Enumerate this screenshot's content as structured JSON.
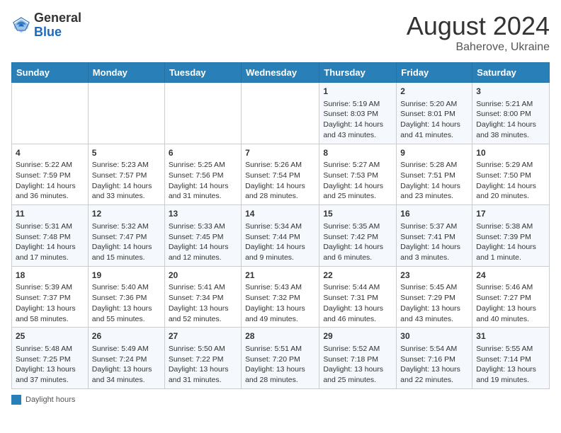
{
  "header": {
    "logo_general": "General",
    "logo_blue": "Blue",
    "month_year": "August 2024",
    "location": "Baherove, Ukraine"
  },
  "days_of_week": [
    "Sunday",
    "Monday",
    "Tuesday",
    "Wednesday",
    "Thursday",
    "Friday",
    "Saturday"
  ],
  "legend": {
    "label": "Daylight hours"
  },
  "weeks": [
    [
      {
        "day": "",
        "sunrise": "",
        "sunset": "",
        "daylight": ""
      },
      {
        "day": "",
        "sunrise": "",
        "sunset": "",
        "daylight": ""
      },
      {
        "day": "",
        "sunrise": "",
        "sunset": "",
        "daylight": ""
      },
      {
        "day": "",
        "sunrise": "",
        "sunset": "",
        "daylight": ""
      },
      {
        "day": "1",
        "sunrise": "Sunrise: 5:19 AM",
        "sunset": "Sunset: 8:03 PM",
        "daylight": "Daylight: 14 hours and 43 minutes."
      },
      {
        "day": "2",
        "sunrise": "Sunrise: 5:20 AM",
        "sunset": "Sunset: 8:01 PM",
        "daylight": "Daylight: 14 hours and 41 minutes."
      },
      {
        "day": "3",
        "sunrise": "Sunrise: 5:21 AM",
        "sunset": "Sunset: 8:00 PM",
        "daylight": "Daylight: 14 hours and 38 minutes."
      }
    ],
    [
      {
        "day": "4",
        "sunrise": "Sunrise: 5:22 AM",
        "sunset": "Sunset: 7:59 PM",
        "daylight": "Daylight: 14 hours and 36 minutes."
      },
      {
        "day": "5",
        "sunrise": "Sunrise: 5:23 AM",
        "sunset": "Sunset: 7:57 PM",
        "daylight": "Daylight: 14 hours and 33 minutes."
      },
      {
        "day": "6",
        "sunrise": "Sunrise: 5:25 AM",
        "sunset": "Sunset: 7:56 PM",
        "daylight": "Daylight: 14 hours and 31 minutes."
      },
      {
        "day": "7",
        "sunrise": "Sunrise: 5:26 AM",
        "sunset": "Sunset: 7:54 PM",
        "daylight": "Daylight: 14 hours and 28 minutes."
      },
      {
        "day": "8",
        "sunrise": "Sunrise: 5:27 AM",
        "sunset": "Sunset: 7:53 PM",
        "daylight": "Daylight: 14 hours and 25 minutes."
      },
      {
        "day": "9",
        "sunrise": "Sunrise: 5:28 AM",
        "sunset": "Sunset: 7:51 PM",
        "daylight": "Daylight: 14 hours and 23 minutes."
      },
      {
        "day": "10",
        "sunrise": "Sunrise: 5:29 AM",
        "sunset": "Sunset: 7:50 PM",
        "daylight": "Daylight: 14 hours and 20 minutes."
      }
    ],
    [
      {
        "day": "11",
        "sunrise": "Sunrise: 5:31 AM",
        "sunset": "Sunset: 7:48 PM",
        "daylight": "Daylight: 14 hours and 17 minutes."
      },
      {
        "day": "12",
        "sunrise": "Sunrise: 5:32 AM",
        "sunset": "Sunset: 7:47 PM",
        "daylight": "Daylight: 14 hours and 15 minutes."
      },
      {
        "day": "13",
        "sunrise": "Sunrise: 5:33 AM",
        "sunset": "Sunset: 7:45 PM",
        "daylight": "Daylight: 14 hours and 12 minutes."
      },
      {
        "day": "14",
        "sunrise": "Sunrise: 5:34 AM",
        "sunset": "Sunset: 7:44 PM",
        "daylight": "Daylight: 14 hours and 9 minutes."
      },
      {
        "day": "15",
        "sunrise": "Sunrise: 5:35 AM",
        "sunset": "Sunset: 7:42 PM",
        "daylight": "Daylight: 14 hours and 6 minutes."
      },
      {
        "day": "16",
        "sunrise": "Sunrise: 5:37 AM",
        "sunset": "Sunset: 7:41 PM",
        "daylight": "Daylight: 14 hours and 3 minutes."
      },
      {
        "day": "17",
        "sunrise": "Sunrise: 5:38 AM",
        "sunset": "Sunset: 7:39 PM",
        "daylight": "Daylight: 14 hours and 1 minute."
      }
    ],
    [
      {
        "day": "18",
        "sunrise": "Sunrise: 5:39 AM",
        "sunset": "Sunset: 7:37 PM",
        "daylight": "Daylight: 13 hours and 58 minutes."
      },
      {
        "day": "19",
        "sunrise": "Sunrise: 5:40 AM",
        "sunset": "Sunset: 7:36 PM",
        "daylight": "Daylight: 13 hours and 55 minutes."
      },
      {
        "day": "20",
        "sunrise": "Sunrise: 5:41 AM",
        "sunset": "Sunset: 7:34 PM",
        "daylight": "Daylight: 13 hours and 52 minutes."
      },
      {
        "day": "21",
        "sunrise": "Sunrise: 5:43 AM",
        "sunset": "Sunset: 7:32 PM",
        "daylight": "Daylight: 13 hours and 49 minutes."
      },
      {
        "day": "22",
        "sunrise": "Sunrise: 5:44 AM",
        "sunset": "Sunset: 7:31 PM",
        "daylight": "Daylight: 13 hours and 46 minutes."
      },
      {
        "day": "23",
        "sunrise": "Sunrise: 5:45 AM",
        "sunset": "Sunset: 7:29 PM",
        "daylight": "Daylight: 13 hours and 43 minutes."
      },
      {
        "day": "24",
        "sunrise": "Sunrise: 5:46 AM",
        "sunset": "Sunset: 7:27 PM",
        "daylight": "Daylight: 13 hours and 40 minutes."
      }
    ],
    [
      {
        "day": "25",
        "sunrise": "Sunrise: 5:48 AM",
        "sunset": "Sunset: 7:25 PM",
        "daylight": "Daylight: 13 hours and 37 minutes."
      },
      {
        "day": "26",
        "sunrise": "Sunrise: 5:49 AM",
        "sunset": "Sunset: 7:24 PM",
        "daylight": "Daylight: 13 hours and 34 minutes."
      },
      {
        "day": "27",
        "sunrise": "Sunrise: 5:50 AM",
        "sunset": "Sunset: 7:22 PM",
        "daylight": "Daylight: 13 hours and 31 minutes."
      },
      {
        "day": "28",
        "sunrise": "Sunrise: 5:51 AM",
        "sunset": "Sunset: 7:20 PM",
        "daylight": "Daylight: 13 hours and 28 minutes."
      },
      {
        "day": "29",
        "sunrise": "Sunrise: 5:52 AM",
        "sunset": "Sunset: 7:18 PM",
        "daylight": "Daylight: 13 hours and 25 minutes."
      },
      {
        "day": "30",
        "sunrise": "Sunrise: 5:54 AM",
        "sunset": "Sunset: 7:16 PM",
        "daylight": "Daylight: 13 hours and 22 minutes."
      },
      {
        "day": "31",
        "sunrise": "Sunrise: 5:55 AM",
        "sunset": "Sunset: 7:14 PM",
        "daylight": "Daylight: 13 hours and 19 minutes."
      }
    ]
  ]
}
